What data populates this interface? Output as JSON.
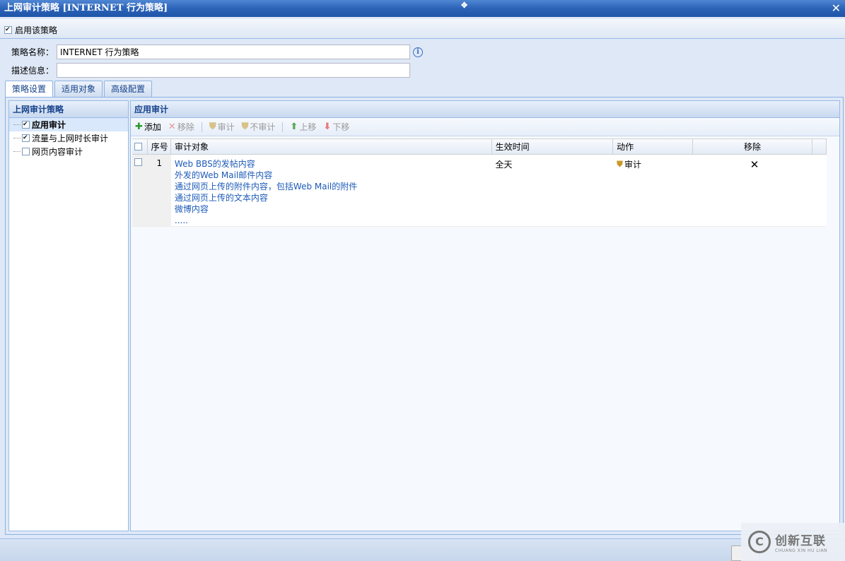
{
  "window": {
    "title": "上网审计策略 [INTERNET 行为策略]",
    "close_glyph": "✕"
  },
  "enable": {
    "label": "启用该策略",
    "checked": true
  },
  "form": {
    "name_label": "策略名称：",
    "name_value": "INTERNET 行为策略",
    "desc_label": "描述信息：",
    "desc_value": ""
  },
  "tabs": [
    "策略设置",
    "适用对象",
    "高级配置"
  ],
  "left_panel": {
    "title": "上网审计策略",
    "items": [
      {
        "label": "应用审计",
        "checked": true
      },
      {
        "label": "流量与上网时长审计",
        "checked": true
      },
      {
        "label": "网页内容审计",
        "checked": false
      }
    ]
  },
  "right_panel": {
    "title": "应用审计",
    "toolbar": {
      "add": "添加",
      "remove": "移除",
      "audit": "审计",
      "no_audit": "不审计",
      "move_up": "上移",
      "move_down": "下移"
    },
    "grid": {
      "headers": [
        "序号",
        "审计对象",
        "生效时间",
        "动作",
        "移除"
      ],
      "rows": [
        {
          "index": "1",
          "objects": [
            "Web BBS的发帖内容",
            "外发的Web Mail邮件内容",
            "通过网页上传的附件内容，包括Web Mail的附件",
            "通过网页上传的文本内容",
            "微博内容",
            "....."
          ],
          "time": "全天",
          "action": "审计"
        }
      ]
    }
  },
  "watermark": {
    "cn": "创新互联",
    "en": "CHUANG XIN HU LIAN"
  },
  "colors": {
    "title_bar": "#2b63b8",
    "link": "#1c5ab8",
    "remove": "#d11111"
  }
}
